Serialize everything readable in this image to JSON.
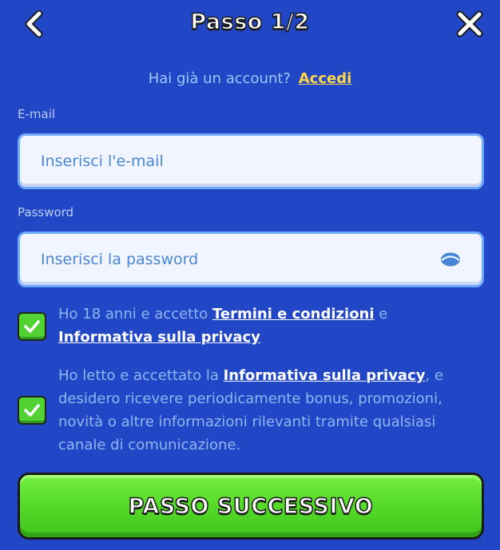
{
  "header": {
    "title": "Passo 1/2",
    "back_icon": "chevron-left-icon",
    "close_icon": "close-icon"
  },
  "login": {
    "question": "Hai già un account?",
    "link": "Accedi"
  },
  "email": {
    "label": "E-mail",
    "placeholder": "Inserisci l'e-mail",
    "value": ""
  },
  "password": {
    "label": "Password",
    "placeholder": "Inserisci la password",
    "value": "",
    "toggle_icon": "eye-icon"
  },
  "consents": [
    {
      "checked": true,
      "text_before": "Ho 18 anni e accetto ",
      "link1": "Termini e condizioni",
      "text_middle": " e ",
      "link2": "Informativa sulla privacy"
    },
    {
      "checked": true,
      "text_before": "Ho letto e accettato la ",
      "link": "Informativa sulla privacy",
      "text_after": ", e desidero ricevere periodicamente bonus, promozioni, novità o altre informazioni rilevanti tramite qualsiasi canale di comunicazione."
    }
  ],
  "next_button": {
    "label": "PASSO SUCCESSIVO"
  },
  "colors": {
    "background": "#2247c6",
    "accent_link": "#ffd84a",
    "button_green": "#58dc2b",
    "input_border": "#6ea8ff"
  }
}
